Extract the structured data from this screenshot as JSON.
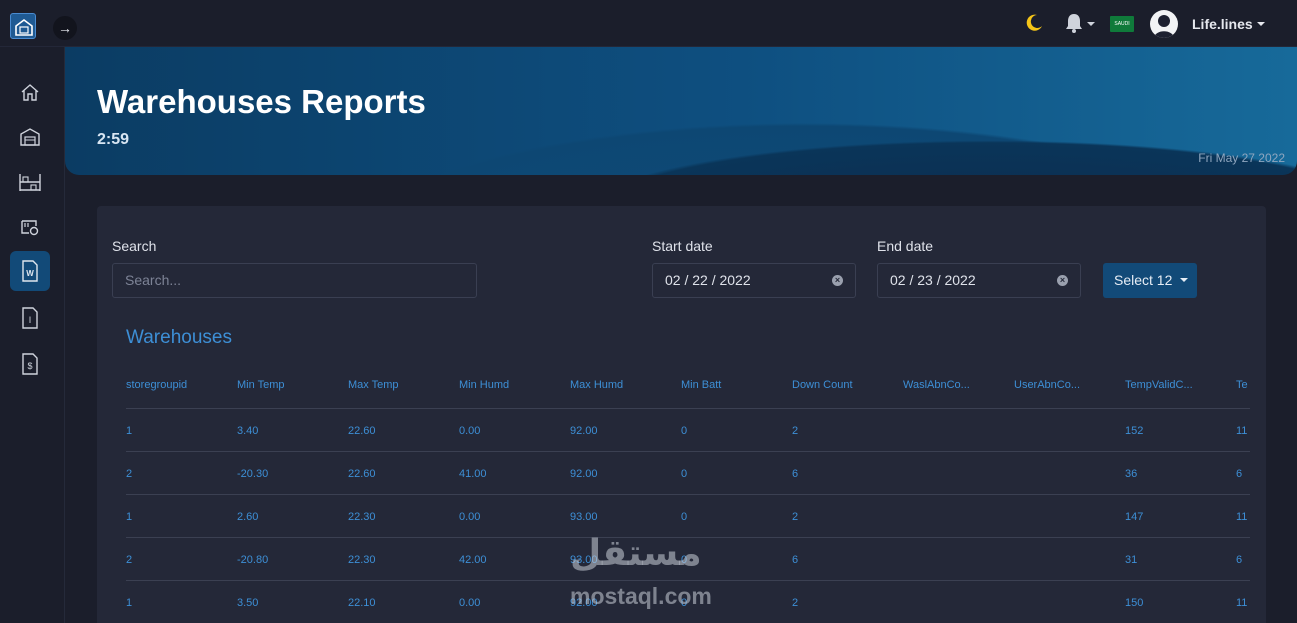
{
  "header": {
    "username": "Life.lines",
    "flag_text": "SAUDI"
  },
  "sidebar": {
    "items": [
      {
        "icon": "home-icon"
      },
      {
        "icon": "warehouse-icon"
      },
      {
        "icon": "shelves-icon"
      },
      {
        "icon": "device-settings-icon"
      },
      {
        "icon": "file-w-icon",
        "letter": "W",
        "active": true
      },
      {
        "icon": "file-i-icon",
        "letter": "I"
      },
      {
        "icon": "file-dollar-icon",
        "letter": "$"
      }
    ]
  },
  "hero": {
    "title": "Warehouses Reports",
    "time": "2:59",
    "date": "Fri May 27 2022"
  },
  "filters": {
    "search_label": "Search",
    "search_placeholder": "Search...",
    "start_label": "Start date",
    "start_value": "02 / 22 / 2022",
    "end_label": "End date",
    "end_value": "02 / 23 / 2022",
    "select_label": "Select 12"
  },
  "table": {
    "title": "Warehouses",
    "columns": [
      "storegroupid",
      "Min Temp",
      "Max Temp",
      "Min Humd",
      "Max Humd",
      "Min Batt",
      "Down Count",
      "WaslAbnCo...",
      "UserAbnCo...",
      "TempValidC...",
      "Te"
    ],
    "rows": [
      [
        "1",
        "3.40",
        "22.60",
        "0.00",
        "92.00",
        "0",
        "2",
        "",
        "",
        "152",
        "11"
      ],
      [
        "2",
        "-20.30",
        "22.60",
        "41.00",
        "92.00",
        "0",
        "6",
        "",
        "",
        "36",
        "6"
      ],
      [
        "1",
        "2.60",
        "22.30",
        "0.00",
        "93.00",
        "0",
        "2",
        "",
        "",
        "147",
        "11"
      ],
      [
        "2",
        "-20.80",
        "22.30",
        "42.00",
        "93.00",
        "0",
        "6",
        "",
        "",
        "31",
        "6"
      ],
      [
        "1",
        "3.50",
        "22.10",
        "0.00",
        "92.00",
        "0",
        "2",
        "",
        "",
        "150",
        "11"
      ]
    ]
  },
  "watermark": {
    "logo_text": "مستقل",
    "text": "mostaql.com"
  },
  "colors": {
    "background": "#1b1e2b",
    "card": "#242838",
    "accent": "#3d8fd6",
    "button": "#124a78"
  }
}
